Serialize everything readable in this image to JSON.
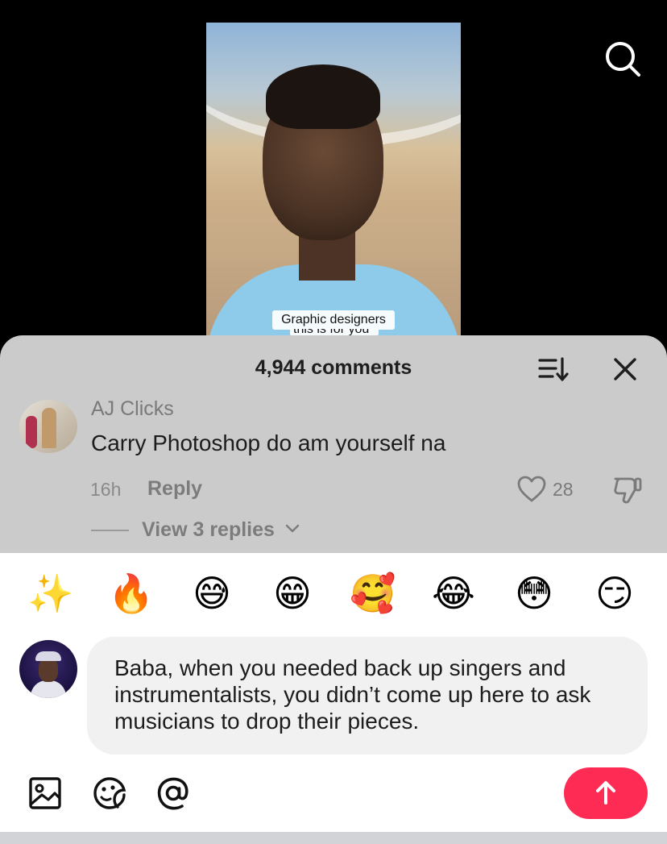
{
  "video": {
    "caption_line1": "Graphic designers",
    "caption_line2": "this is for you"
  },
  "comments": {
    "count_label": "4,944 comments",
    "items": [
      {
        "username": "AJ Clicks",
        "text": "Carry Photoshop do am yourself na",
        "time": "16h",
        "reply_label": "Reply",
        "likes": "28",
        "view_replies_label": "View 3 replies"
      }
    ]
  },
  "quick_emojis": [
    "✨",
    "🔥",
    "😅",
    "😁",
    "🥰",
    "😂",
    "😳",
    "😏"
  ],
  "composer": {
    "text": "Baba, when you needed back up singers and instrumentalists, you didn’t come up here to ask musicians to drop their pieces."
  },
  "colors": {
    "accent": "#fe2c55",
    "sheet_dimmed": "#cbcbcb",
    "input_bg": "#f1f1f2"
  }
}
